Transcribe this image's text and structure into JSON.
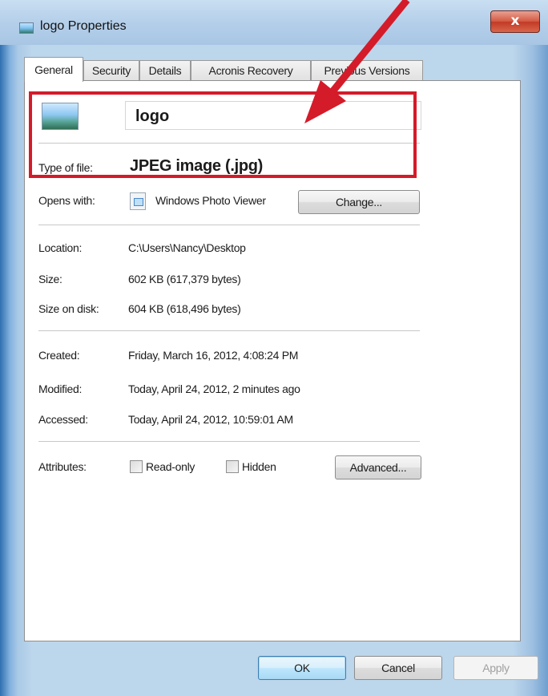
{
  "window": {
    "title": "logo Properties",
    "close_glyph": "x"
  },
  "tabs": [
    {
      "label": "General",
      "active": true
    },
    {
      "label": "Security",
      "active": false
    },
    {
      "label": "Details",
      "active": false
    },
    {
      "label": "Acronis Recovery",
      "active": false
    },
    {
      "label": "Previous Versions",
      "active": false
    }
  ],
  "file": {
    "name": "logo",
    "icon": "jpeg-image-icon"
  },
  "type_of_file": {
    "label": "Type of file:",
    "value": "JPEG image (.jpg)"
  },
  "opens_with": {
    "label": "Opens with:",
    "app": "Windows Photo Viewer",
    "app_icon": "photo-viewer-icon",
    "change_label": "Change..."
  },
  "location": {
    "label": "Location:",
    "value": "C:\\Users\\Nancy\\Desktop"
  },
  "size": {
    "label": "Size:",
    "value": "602 KB (617,379 bytes)"
  },
  "size_on_disk": {
    "label": "Size on disk:",
    "value": "604 KB (618,496 bytes)"
  },
  "created": {
    "label": "Created:",
    "value": "Friday, March 16, 2012, 4:08:24 PM"
  },
  "modified": {
    "label": "Modified:",
    "value": "Today, April 24, 2012, 2 minutes ago"
  },
  "accessed": {
    "label": "Accessed:",
    "value": "Today, April 24, 2012, 10:59:01 AM"
  },
  "attributes": {
    "label": "Attributes:",
    "readonly_label": "Read-only",
    "readonly_checked": false,
    "hidden_label": "Hidden",
    "hidden_checked": false,
    "advanced_label": "Advanced..."
  },
  "buttons": {
    "ok": "OK",
    "cancel": "Cancel",
    "apply": "Apply"
  },
  "annotation": {
    "highlight_color": "#d41b2a",
    "arrow_color": "#d41b2a"
  }
}
